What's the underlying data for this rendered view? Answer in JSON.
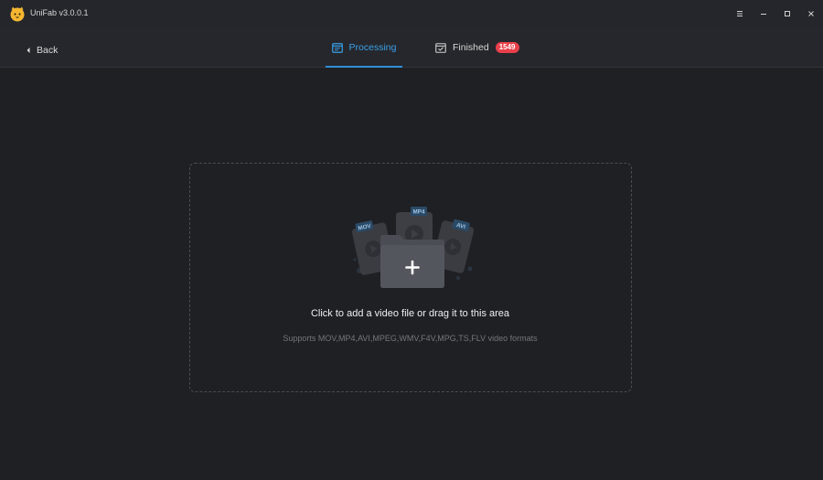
{
  "app": {
    "title": "UniFab v3.0.0.1"
  },
  "window_controls": [
    "menu-icon",
    "minimize-icon",
    "maximize-icon",
    "close-icon"
  ],
  "nav": {
    "back_label": "Back",
    "tabs": [
      {
        "label": "Processing",
        "active": true
      },
      {
        "label": "Finished",
        "badge": "1549"
      }
    ]
  },
  "dropzone": {
    "title": "Click to add a video file or drag it to this area",
    "subtitle": "Supports MOV,MP4,AVI,MPEG,WMV,F4V,MPG,TS,FLV video formats",
    "file_tags": [
      "MOV",
      "MP4",
      "AVI"
    ]
  },
  "colors": {
    "accent": "#3aa0e8",
    "badge": "#e8404a",
    "background": "#1f2024"
  }
}
